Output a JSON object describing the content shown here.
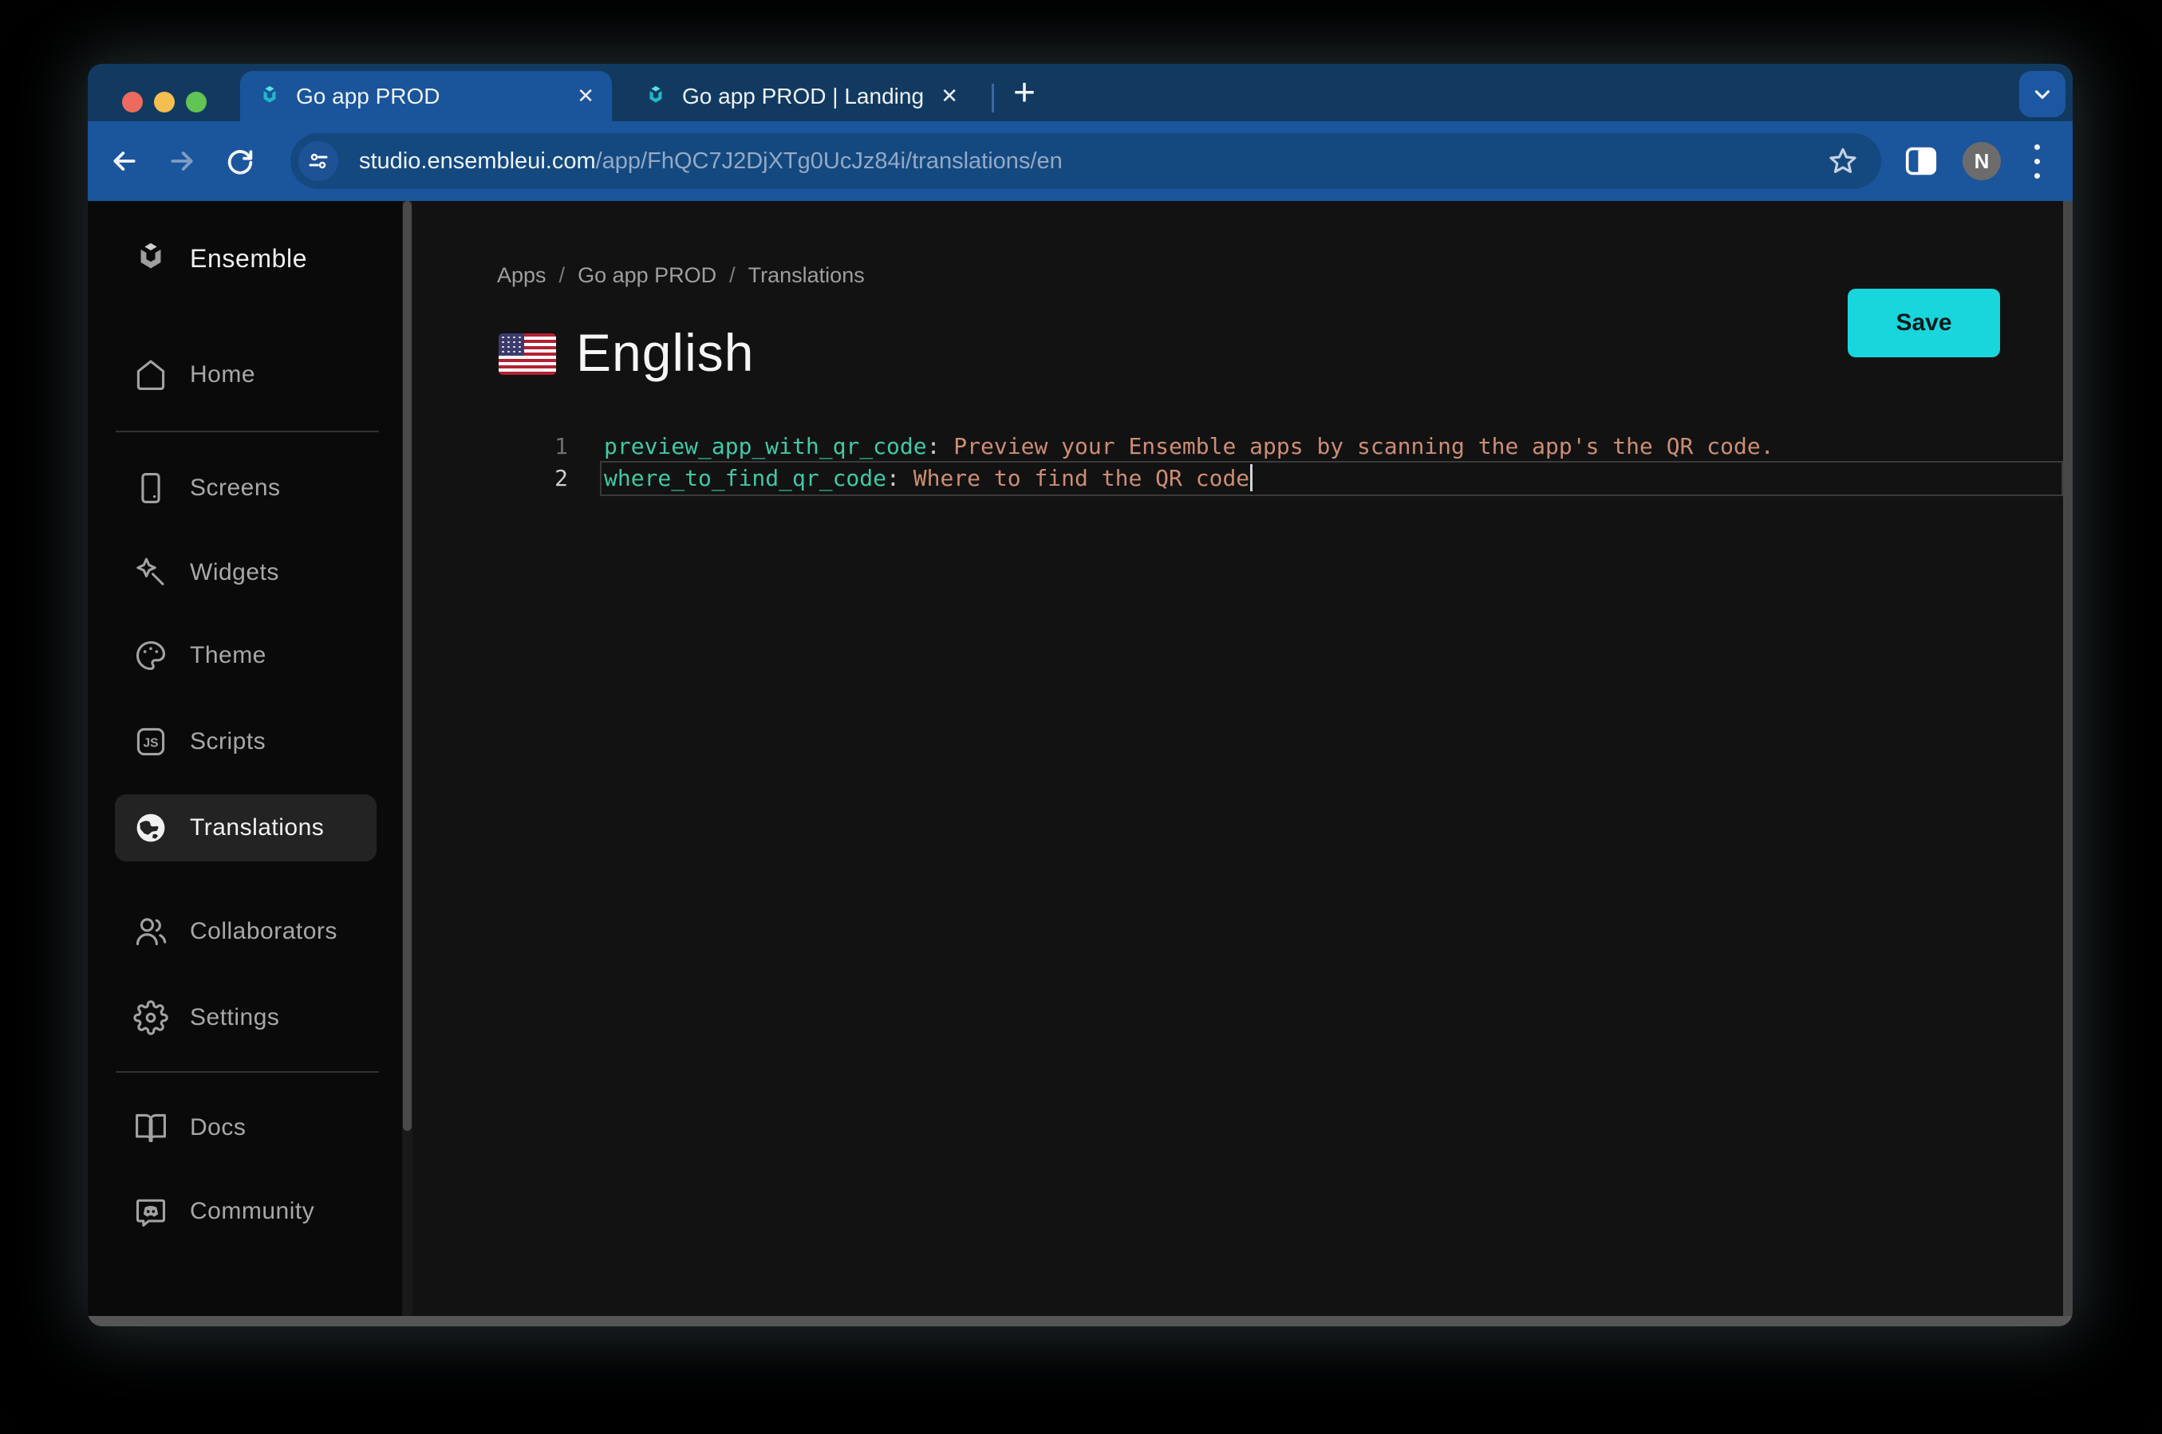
{
  "browser": {
    "traffic_light_colors": [
      "#ed6a5e",
      "#f4bf4f",
      "#61c454"
    ],
    "tabs": [
      {
        "title": "Go app PROD"
      },
      {
        "title": "Go app PROD | Landing"
      }
    ],
    "close_glyph": "✕",
    "new_tab_glyph": "+",
    "url": {
      "host": "studio.ensembleui.com",
      "path": "/app/FhQC7J2DjXTg0UcJz84i/translations/en"
    },
    "avatar_initial": "N"
  },
  "sidebar": {
    "brand": "Ensemble",
    "items": [
      {
        "label": "Home"
      },
      {
        "label": "Screens"
      },
      {
        "label": "Widgets"
      },
      {
        "label": "Theme"
      },
      {
        "label": "Scripts",
        "badge": "JS"
      },
      {
        "label": "Translations",
        "active": true
      },
      {
        "label": "Collaborators"
      },
      {
        "label": "Settings"
      },
      {
        "label": "Docs"
      },
      {
        "label": "Community"
      }
    ]
  },
  "main": {
    "breadcrumb": {
      "items": [
        "Apps",
        "Go app PROD",
        "Translations"
      ],
      "separator": "/"
    },
    "title": "English",
    "flag": "us-flag",
    "save_label": "Save",
    "accent_color": "#19d6dc"
  },
  "editor": {
    "colors": {
      "key": "#3fc9a5",
      "value": "#cd8d74",
      "punct": "#cfcfcf"
    },
    "lines": [
      {
        "num": "1",
        "key": "preview_app_with_qr_code",
        "colon": ":",
        "value": " Preview your Ensemble apps by scanning the app's the QR code."
      },
      {
        "num": "2",
        "key": "where_to_find_qr_code",
        "colon": ":",
        "value": " Where to find the QR code",
        "active": true
      }
    ]
  }
}
